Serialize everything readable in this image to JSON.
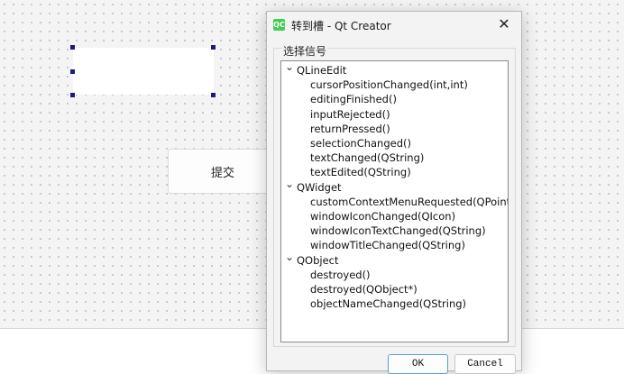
{
  "designer": {
    "submit_button": "提交"
  },
  "dialog": {
    "app_icon_text": "QC",
    "title": "转到槽 - Qt Creator",
    "close_glyph": "✕",
    "group_label": "选择信号",
    "ok_label": "OK",
    "cancel_label": "Cancel",
    "selected_signal": "textEdited(QString)",
    "signals": [
      {
        "class": "QLineEdit",
        "expanded": true,
        "items": [
          "cursorPositionChanged(int,int)",
          "editingFinished()",
          "inputRejected()",
          "returnPressed()",
          "selectionChanged()",
          "textChanged(QString)",
          "textEdited(QString)"
        ]
      },
      {
        "class": "QWidget",
        "expanded": true,
        "items": [
          "customContextMenuRequested(QPoint)",
          "windowIconChanged(QIcon)",
          "windowIconTextChanged(QString)",
          "windowTitleChanged(QString)"
        ]
      },
      {
        "class": "QObject",
        "expanded": true,
        "items": [
          "destroyed()",
          "destroyed(QObject*)",
          "objectNameChanged(QString)"
        ]
      }
    ]
  },
  "icons": {
    "expand": "chevron-down-icon",
    "close": "close-icon"
  }
}
